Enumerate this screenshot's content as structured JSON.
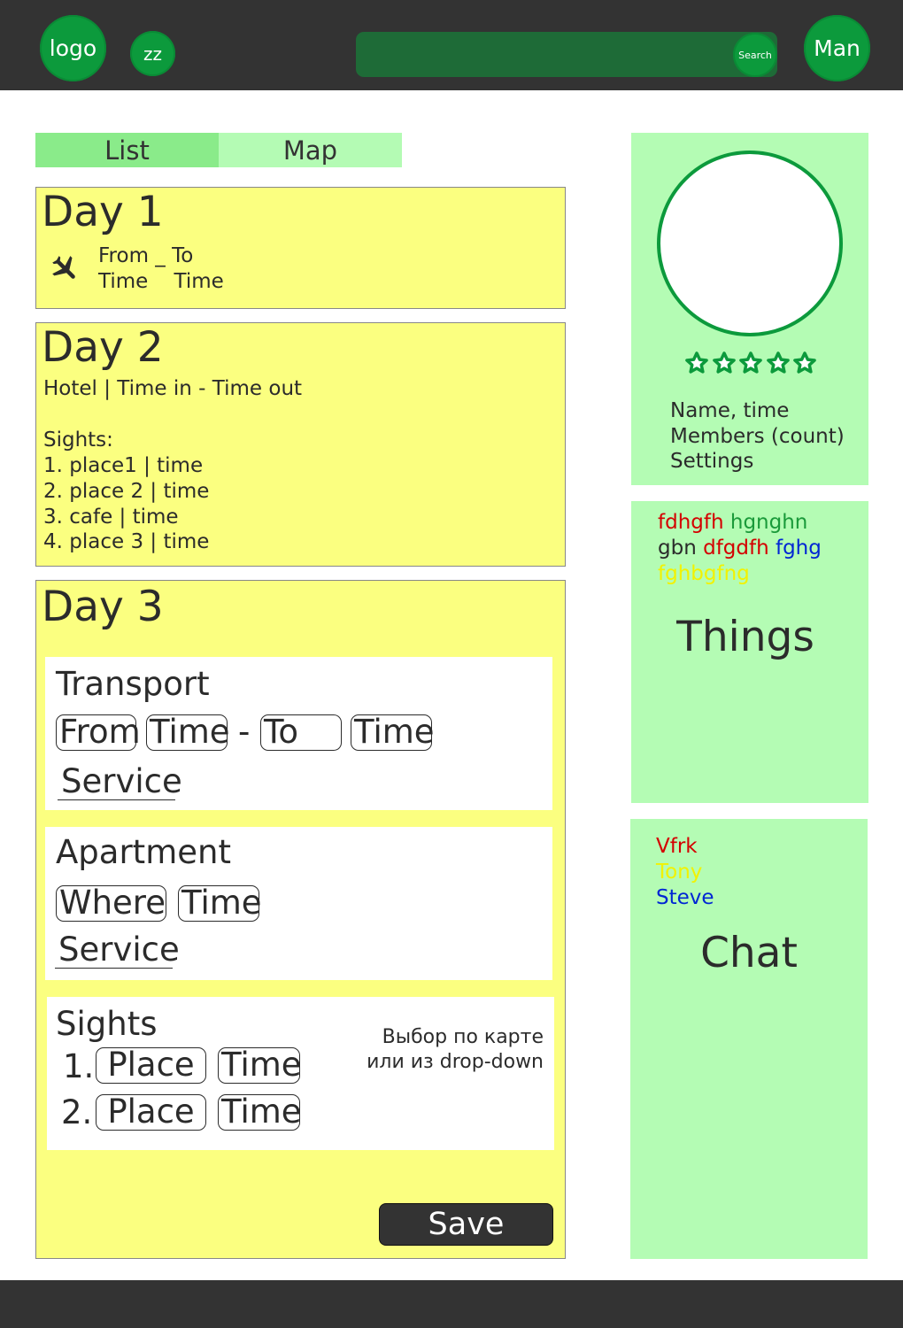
{
  "header": {
    "logo": "logo",
    "zz": "zz",
    "search_button": "Search",
    "user": "Man"
  },
  "tabs": [
    "List",
    "Map"
  ],
  "day1": {
    "title": "Day 1",
    "flight_line1": "From _ To",
    "flight_line2": "Time    Time",
    "icon": "airplane-icon"
  },
  "day2": {
    "title": "Day 2",
    "hotel": "Hotel | Time in - Time out",
    "sights_label": "Sights:",
    "sights": [
      "1. place1 | time",
      "2. place 2 | time",
      "3. cafe | time",
      "4. place 3 | time"
    ]
  },
  "day3": {
    "title": "Day 3",
    "transport": {
      "title": "Transport",
      "from": "From",
      "time1": "Time",
      "dash": "-",
      "to": "To",
      "time2": "Time",
      "service": "Service"
    },
    "apartment": {
      "title": "Apartment",
      "where": "Where",
      "time": "Time",
      "service": "Service"
    },
    "sights": {
      "title": "Sights",
      "rows": [
        {
          "num": "1.",
          "place": "Place",
          "time": "Time"
        },
        {
          "num": "2.",
          "place": "Place",
          "time": "Time"
        }
      ],
      "note_line1": "Выбор по карте",
      "note_line2": "или из drop-down"
    },
    "save": "Save"
  },
  "profile": {
    "rating": 5,
    "name_time": "Name, time",
    "members": "Members (count)",
    "settings": "Settings",
    "accent": "#0c9a3c"
  },
  "things": {
    "tags": [
      {
        "text": "fdhgfh",
        "color": "#d40000"
      },
      {
        "text": "hgnghn",
        "color": "#1a9a3a"
      },
      {
        "text": "gbn",
        "color": "#2b2b2b"
      },
      {
        "text": "dfgdfh",
        "color": "#d40000"
      },
      {
        "text": "fghg",
        "color": "#0026d4"
      },
      {
        "text": "fghbgfng",
        "color": "#f2f200"
      }
    ],
    "label": "Things"
  },
  "chat": {
    "users": [
      {
        "name": "Vfrk",
        "color": "#d40000"
      },
      {
        "name": "Tony",
        "color": "#f2f200"
      },
      {
        "name": "Steve",
        "color": "#0026d4"
      }
    ],
    "label": "Chat"
  }
}
